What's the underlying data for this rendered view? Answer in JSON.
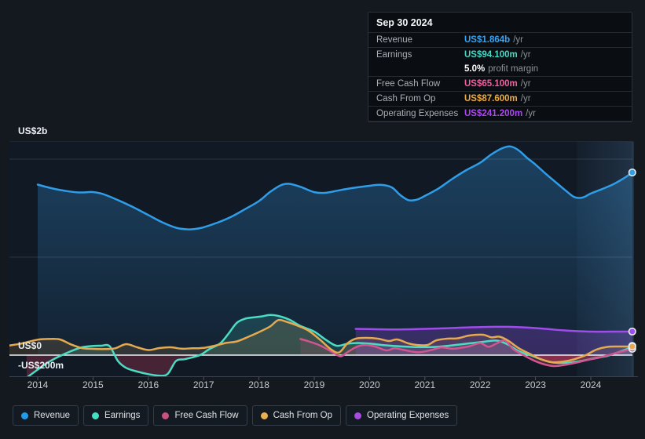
{
  "tooltip": {
    "date": "Sep 30 2024",
    "profit_margin_bold": "5.0%",
    "profit_margin_text": "profit margin",
    "rows": [
      {
        "label": "Revenue",
        "value": "US$1.864b",
        "suffix": "/yr",
        "color": "#35A4F4"
      },
      {
        "label": "Earnings",
        "value": "US$94.100m",
        "suffix": "/yr",
        "color": "#43D9C5"
      },
      {
        "label": "Free Cash Flow",
        "value": "US$65.100m",
        "suffix": "/yr",
        "color": "#F0609F"
      },
      {
        "label": "Cash From Op",
        "value": "US$87.600m",
        "suffix": "/yr",
        "color": "#EFAC3E"
      },
      {
        "label": "Operating Expenses",
        "value": "US$241.200m",
        "suffix": "/yr",
        "color": "#AE47F2"
      }
    ]
  },
  "y_axis": {
    "labels": [
      {
        "text": "US$2b",
        "value": 2000
      },
      {
        "text": "US$0",
        "value": 0
      },
      {
        "text": "-US$200m",
        "value": -200
      }
    ]
  },
  "x_axis": {
    "years": [
      2014,
      2015,
      2016,
      2017,
      2018,
      2019,
      2020,
      2021,
      2022,
      2023,
      2024
    ]
  },
  "legend": [
    {
      "label": "Revenue",
      "color": "#1F9DED"
    },
    {
      "label": "Earnings",
      "color": "#45DEC5"
    },
    {
      "label": "Free Cash Flow",
      "color": "#C8517F"
    },
    {
      "label": "Cash From Op",
      "color": "#EAB04F"
    },
    {
      "label": "Operating Expenses",
      "color": "#A94AE2"
    }
  ],
  "chart_data": {
    "type": "area",
    "title": "",
    "xlabel": "",
    "ylabel": "US$",
    "y_unit": "US$ millions",
    "x_range": [
      2013.45,
      2024.78
    ],
    "ylim": [
      -224,
      2184
    ],
    "y_gridlines": [
      2000,
      1000
    ],
    "zero_line": 0,
    "grid": true,
    "legend_position": "bottom",
    "highlight_band": {
      "from": 2023.75,
      "to": 2024.78
    },
    "negative_fill": "#C83D5F",
    "series": [
      {
        "id": "revenue",
        "name": "Revenue",
        "color": "#2F9DE8",
        "fill_opacity": 0.3,
        "points": [
          [
            2014.0,
            1740
          ],
          [
            2014.25,
            1703
          ],
          [
            2014.5,
            1676
          ],
          [
            2014.75,
            1660
          ],
          [
            2015.0,
            1664
          ],
          [
            2015.2,
            1640
          ],
          [
            2015.5,
            1570
          ],
          [
            2015.75,
            1503
          ],
          [
            2016.0,
            1430
          ],
          [
            2016.25,
            1356
          ],
          [
            2016.5,
            1300
          ],
          [
            2016.7,
            1284
          ],
          [
            2016.85,
            1288
          ],
          [
            2017.0,
            1305
          ],
          [
            2017.25,
            1352
          ],
          [
            2017.5,
            1412
          ],
          [
            2017.75,
            1490
          ],
          [
            2018.0,
            1572
          ],
          [
            2018.2,
            1665
          ],
          [
            2018.4,
            1735
          ],
          [
            2018.55,
            1748
          ],
          [
            2018.75,
            1718
          ],
          [
            2019.0,
            1663
          ],
          [
            2019.2,
            1656
          ],
          [
            2019.45,
            1682
          ],
          [
            2019.7,
            1706
          ],
          [
            2020.0,
            1728
          ],
          [
            2020.2,
            1738
          ],
          [
            2020.4,
            1712
          ],
          [
            2020.55,
            1636
          ],
          [
            2020.7,
            1582
          ],
          [
            2020.85,
            1586
          ],
          [
            2021.0,
            1625
          ],
          [
            2021.25,
            1702
          ],
          [
            2021.5,
            1800
          ],
          [
            2021.75,
            1888
          ],
          [
            2022.0,
            1963
          ],
          [
            2022.2,
            2048
          ],
          [
            2022.4,
            2112
          ],
          [
            2022.55,
            2130
          ],
          [
            2022.7,
            2088
          ],
          [
            2022.85,
            2012
          ],
          [
            2023.0,
            1945
          ],
          [
            2023.2,
            1843
          ],
          [
            2023.4,
            1748
          ],
          [
            2023.55,
            1678
          ],
          [
            2023.7,
            1614
          ],
          [
            2023.85,
            1608
          ],
          [
            2024.0,
            1650
          ],
          [
            2024.2,
            1694
          ],
          [
            2024.4,
            1742
          ],
          [
            2024.6,
            1806
          ],
          [
            2024.75,
            1864
          ]
        ]
      },
      {
        "id": "earnings",
        "name": "Earnings",
        "color": "#4BDCC4",
        "fill_opacity": 0.16,
        "points": [
          [
            2013.8,
            -230
          ],
          [
            2014.0,
            -148
          ],
          [
            2014.2,
            -70
          ],
          [
            2014.4,
            -10
          ],
          [
            2014.6,
            40
          ],
          [
            2014.8,
            80
          ],
          [
            2015.0,
            94
          ],
          [
            2015.15,
            96
          ],
          [
            2015.3,
            92
          ],
          [
            2015.45,
            -60
          ],
          [
            2015.6,
            -130
          ],
          [
            2015.8,
            -168
          ],
          [
            2016.0,
            -194
          ],
          [
            2016.2,
            -210
          ],
          [
            2016.35,
            -192
          ],
          [
            2016.5,
            -60
          ],
          [
            2016.65,
            -42
          ],
          [
            2016.8,
            -22
          ],
          [
            2016.95,
            5
          ],
          [
            2017.1,
            60
          ],
          [
            2017.3,
            120
          ],
          [
            2017.45,
            220
          ],
          [
            2017.6,
            330
          ],
          [
            2017.75,
            372
          ],
          [
            2017.9,
            385
          ],
          [
            2018.05,
            395
          ],
          [
            2018.2,
            410
          ],
          [
            2018.35,
            400
          ],
          [
            2018.55,
            362
          ],
          [
            2018.75,
            298
          ],
          [
            2019.0,
            240
          ],
          [
            2019.2,
            160
          ],
          [
            2019.4,
            96
          ],
          [
            2019.6,
            116
          ],
          [
            2019.8,
            124
          ],
          [
            2020.0,
            118
          ],
          [
            2020.3,
            100
          ],
          [
            2020.6,
            88
          ],
          [
            2020.9,
            82
          ],
          [
            2021.2,
            84
          ],
          [
            2021.5,
            100
          ],
          [
            2021.8,
            120
          ],
          [
            2022.0,
            132
          ],
          [
            2022.3,
            148
          ],
          [
            2022.5,
            108
          ],
          [
            2022.7,
            40
          ],
          [
            2022.9,
            0
          ],
          [
            2023.1,
            -42
          ],
          [
            2023.3,
            -74
          ],
          [
            2023.5,
            -80
          ],
          [
            2023.7,
            -70
          ],
          [
            2023.9,
            -52
          ],
          [
            2024.1,
            -28
          ],
          [
            2024.3,
            -8
          ],
          [
            2024.5,
            30
          ],
          [
            2024.65,
            62
          ],
          [
            2024.75,
            94
          ]
        ]
      },
      {
        "id": "fcf",
        "name": "Free Cash Flow",
        "color": "#D4548F",
        "fill_opacity": 0.14,
        "points": [
          [
            2018.75,
            165
          ],
          [
            2018.9,
            140
          ],
          [
            2019.1,
            100
          ],
          [
            2019.3,
            40
          ],
          [
            2019.47,
            -12
          ],
          [
            2019.6,
            30
          ],
          [
            2019.75,
            80
          ],
          [
            2019.9,
            104
          ],
          [
            2020.1,
            88
          ],
          [
            2020.3,
            48
          ],
          [
            2020.45,
            70
          ],
          [
            2020.6,
            55
          ],
          [
            2020.75,
            38
          ],
          [
            2020.9,
            30
          ],
          [
            2021.1,
            50
          ],
          [
            2021.3,
            78
          ],
          [
            2021.5,
            65
          ],
          [
            2021.65,
            75
          ],
          [
            2021.8,
            90
          ],
          [
            2022.0,
            122
          ],
          [
            2022.15,
            85
          ],
          [
            2022.3,
            120
          ],
          [
            2022.45,
            150
          ],
          [
            2022.6,
            60
          ],
          [
            2022.8,
            -5
          ],
          [
            2023.0,
            -62
          ],
          [
            2023.2,
            -100
          ],
          [
            2023.35,
            -112
          ],
          [
            2023.55,
            -98
          ],
          [
            2023.75,
            -75
          ],
          [
            2023.95,
            -48
          ],
          [
            2024.15,
            -25
          ],
          [
            2024.35,
            5
          ],
          [
            2024.55,
            35
          ],
          [
            2024.75,
            65
          ]
        ]
      },
      {
        "id": "cash_from_op",
        "name": "Cash From Op",
        "color": "#E5A94F",
        "fill_opacity": 0.15,
        "points": [
          [
            2013.45,
            95
          ],
          [
            2013.7,
            118
          ],
          [
            2014.0,
            158
          ],
          [
            2014.2,
            165
          ],
          [
            2014.4,
            160
          ],
          [
            2014.6,
            110
          ],
          [
            2014.8,
            72
          ],
          [
            2015.0,
            64
          ],
          [
            2015.2,
            62
          ],
          [
            2015.4,
            70
          ],
          [
            2015.6,
            112
          ],
          [
            2015.8,
            80
          ],
          [
            2016.0,
            52
          ],
          [
            2016.2,
            72
          ],
          [
            2016.4,
            80
          ],
          [
            2016.6,
            66
          ],
          [
            2016.8,
            70
          ],
          [
            2017.0,
            74
          ],
          [
            2017.2,
            96
          ],
          [
            2017.4,
            124
          ],
          [
            2017.6,
            140
          ],
          [
            2017.8,
            185
          ],
          [
            2018.0,
            235
          ],
          [
            2018.2,
            292
          ],
          [
            2018.35,
            358
          ],
          [
            2018.5,
            340
          ],
          [
            2018.7,
            300
          ],
          [
            2018.9,
            248
          ],
          [
            2019.1,
            160
          ],
          [
            2019.3,
            60
          ],
          [
            2019.45,
            28
          ],
          [
            2019.6,
            120
          ],
          [
            2019.75,
            168
          ],
          [
            2019.95,
            176
          ],
          [
            2020.15,
            168
          ],
          [
            2020.35,
            144
          ],
          [
            2020.5,
            160
          ],
          [
            2020.7,
            120
          ],
          [
            2020.85,
            104
          ],
          [
            2021.05,
            104
          ],
          [
            2021.2,
            150
          ],
          [
            2021.4,
            168
          ],
          [
            2021.6,
            172
          ],
          [
            2021.8,
            200
          ],
          [
            2022.05,
            208
          ],
          [
            2022.2,
            182
          ],
          [
            2022.35,
            188
          ],
          [
            2022.5,
            150
          ],
          [
            2022.7,
            70
          ],
          [
            2022.9,
            12
          ],
          [
            2023.1,
            -42
          ],
          [
            2023.3,
            -72
          ],
          [
            2023.5,
            -66
          ],
          [
            2023.7,
            -42
          ],
          [
            2023.9,
            -2
          ],
          [
            2024.1,
            56
          ],
          [
            2024.3,
            84
          ],
          [
            2024.5,
            88
          ],
          [
            2024.75,
            88
          ]
        ]
      },
      {
        "id": "opex",
        "name": "Operating Expenses",
        "color": "#A04BEB",
        "fill_opacity": 0.26,
        "points": [
          [
            2019.75,
            268
          ],
          [
            2020.0,
            266
          ],
          [
            2020.25,
            263
          ],
          [
            2020.5,
            262
          ],
          [
            2020.75,
            264
          ],
          [
            2021.0,
            268
          ],
          [
            2021.25,
            272
          ],
          [
            2021.5,
            277
          ],
          [
            2021.75,
            282
          ],
          [
            2022.0,
            286
          ],
          [
            2022.25,
            289
          ],
          [
            2022.5,
            289
          ],
          [
            2022.75,
            284
          ],
          [
            2023.0,
            276
          ],
          [
            2023.25,
            265
          ],
          [
            2023.5,
            253
          ],
          [
            2023.75,
            245
          ],
          [
            2024.0,
            240
          ],
          [
            2024.25,
            239
          ],
          [
            2024.5,
            240
          ],
          [
            2024.75,
            241
          ]
        ]
      }
    ]
  }
}
